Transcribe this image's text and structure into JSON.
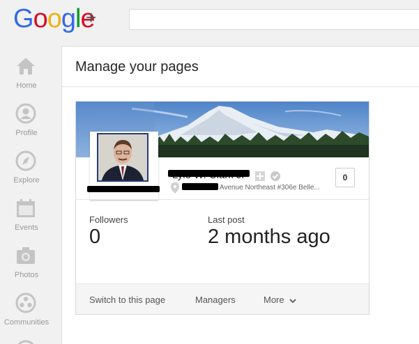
{
  "logo": {
    "letters": [
      "G",
      "o",
      "o",
      "g",
      "l",
      "e"
    ],
    "letter_colors": [
      "#3369e8",
      "#d50f25",
      "#eeb211",
      "#3369e8",
      "#009925",
      "#d50f25"
    ],
    "plus": "+"
  },
  "search": {
    "placeholder": ""
  },
  "nav": {
    "items": [
      {
        "label": "Home",
        "icon": "home-icon"
      },
      {
        "label": "Profile",
        "icon": "profile-icon"
      },
      {
        "label": "Explore",
        "icon": "compass-icon"
      },
      {
        "label": "Events",
        "icon": "calendar-icon"
      },
      {
        "label": "Photos",
        "icon": "camera-icon"
      },
      {
        "label": "Communities",
        "icon": "communities-icon"
      }
    ]
  },
  "main": {
    "title": "Manage your pages",
    "card": {
      "page_name": "Lyle W. Clark Jr",
      "address": "Avenue Northeast #306e Belle...",
      "count": "0",
      "followers_label": "Followers",
      "followers_value": "0",
      "last_post_label": "Last post",
      "last_post_value": "2 months ago",
      "footer": {
        "switch_label": "Switch to this page",
        "managers_label": "Managers",
        "more_label": "More"
      }
    }
  },
  "colors": {
    "accent": "#3369e8",
    "frame": "#233c72"
  }
}
